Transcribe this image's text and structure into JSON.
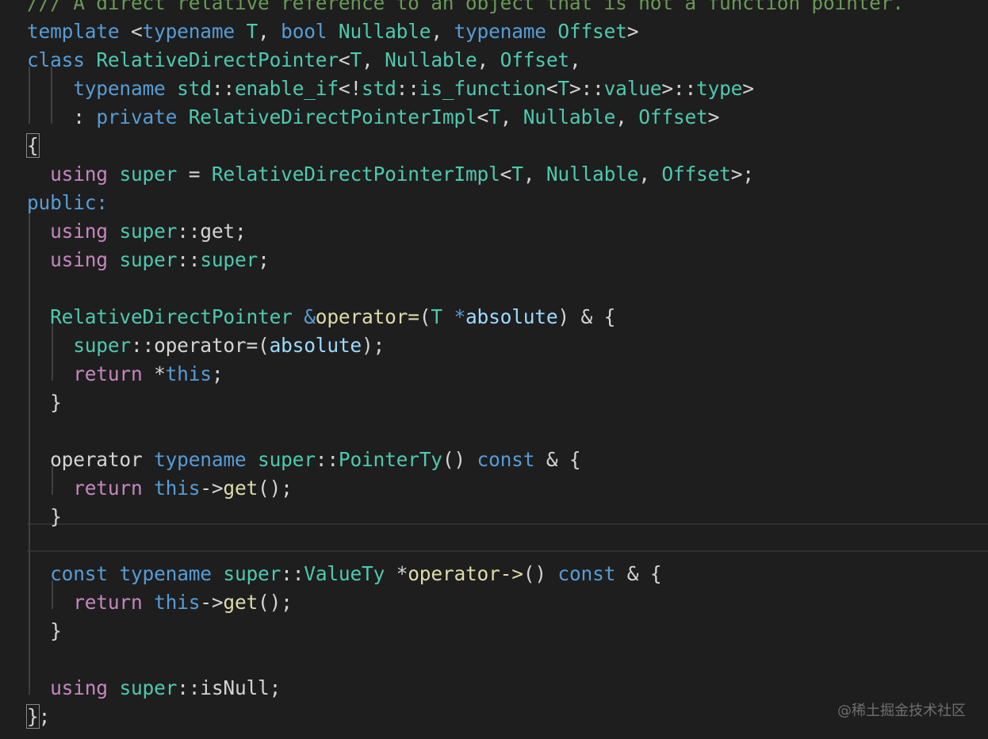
{
  "colors": {
    "background": "#1e1e1e",
    "plain": "#d4d4d4",
    "keyword": "#569cd6",
    "control": "#c586c0",
    "type": "#4ec9b0",
    "function": "#dcdcaa",
    "variable": "#9cdcfe",
    "comment": "#6a9955",
    "watermark": "#6f6f6f"
  },
  "lines": [
    [
      {
        "t": "/// A direct relative reference to an object that is not a function pointer.",
        "c": "comment"
      }
    ],
    [
      {
        "t": "template",
        "c": "keyword"
      },
      {
        "t": " <",
        "c": "plain"
      },
      {
        "t": "typename",
        "c": "keyword"
      },
      {
        "t": " ",
        "c": "plain"
      },
      {
        "t": "T",
        "c": "type"
      },
      {
        "t": ", ",
        "c": "plain"
      },
      {
        "t": "bool",
        "c": "keyword"
      },
      {
        "t": " ",
        "c": "plain"
      },
      {
        "t": "Nullable",
        "c": "type"
      },
      {
        "t": ", ",
        "c": "plain"
      },
      {
        "t": "typename",
        "c": "keyword"
      },
      {
        "t": " ",
        "c": "plain"
      },
      {
        "t": "Offset",
        "c": "type"
      },
      {
        "t": ">",
        "c": "plain"
      }
    ],
    [
      {
        "t": "class",
        "c": "keyword"
      },
      {
        "t": " ",
        "c": "plain"
      },
      {
        "t": "RelativeDirectPointer",
        "c": "type"
      },
      {
        "t": "<",
        "c": "plain"
      },
      {
        "t": "T",
        "c": "type"
      },
      {
        "t": ", ",
        "c": "plain"
      },
      {
        "t": "Nullable",
        "c": "type"
      },
      {
        "t": ", ",
        "c": "plain"
      },
      {
        "t": "Offset",
        "c": "type"
      },
      {
        "t": ",",
        "c": "plain"
      }
    ],
    [
      {
        "t": "    ",
        "c": "plain"
      },
      {
        "t": "typename",
        "c": "keyword"
      },
      {
        "t": " ",
        "c": "plain"
      },
      {
        "t": "std",
        "c": "type"
      },
      {
        "t": "::",
        "c": "plain"
      },
      {
        "t": "enable_if",
        "c": "type"
      },
      {
        "t": "<!",
        "c": "plain"
      },
      {
        "t": "std",
        "c": "type"
      },
      {
        "t": "::",
        "c": "plain"
      },
      {
        "t": "is_function",
        "c": "type"
      },
      {
        "t": "<",
        "c": "plain"
      },
      {
        "t": "T",
        "c": "type"
      },
      {
        "t": ">::",
        "c": "plain"
      },
      {
        "t": "value",
        "c": "type"
      },
      {
        "t": ">::",
        "c": "plain"
      },
      {
        "t": "type",
        "c": "type"
      },
      {
        "t": ">",
        "c": "plain"
      }
    ],
    [
      {
        "t": "    : ",
        "c": "plain"
      },
      {
        "t": "private",
        "c": "keyword"
      },
      {
        "t": " ",
        "c": "plain"
      },
      {
        "t": "RelativeDirectPointerImpl",
        "c": "type"
      },
      {
        "t": "<",
        "c": "plain"
      },
      {
        "t": "T",
        "c": "type"
      },
      {
        "t": ", ",
        "c": "plain"
      },
      {
        "t": "Nullable",
        "c": "type"
      },
      {
        "t": ", ",
        "c": "plain"
      },
      {
        "t": "Offset",
        "c": "type"
      },
      {
        "t": ">",
        "c": "plain"
      }
    ],
    [
      {
        "t": "{",
        "c": "plain",
        "m": 1
      }
    ],
    [
      {
        "t": "  ",
        "c": "plain"
      },
      {
        "t": "using",
        "c": "control"
      },
      {
        "t": " ",
        "c": "plain"
      },
      {
        "t": "super",
        "c": "type"
      },
      {
        "t": " = ",
        "c": "plain"
      },
      {
        "t": "RelativeDirectPointerImpl",
        "c": "type"
      },
      {
        "t": "<",
        "c": "plain"
      },
      {
        "t": "T",
        "c": "type"
      },
      {
        "t": ", ",
        "c": "plain"
      },
      {
        "t": "Nullable",
        "c": "type"
      },
      {
        "t": ", ",
        "c": "plain"
      },
      {
        "t": "Offset",
        "c": "type"
      },
      {
        "t": ">;",
        "c": "plain"
      }
    ],
    [
      {
        "t": "public:",
        "c": "keyword"
      }
    ],
    [
      {
        "t": "  ",
        "c": "plain"
      },
      {
        "t": "using",
        "c": "control"
      },
      {
        "t": " ",
        "c": "plain"
      },
      {
        "t": "super",
        "c": "type"
      },
      {
        "t": "::get;",
        "c": "plain"
      }
    ],
    [
      {
        "t": "  ",
        "c": "plain"
      },
      {
        "t": "using",
        "c": "control"
      },
      {
        "t": " ",
        "c": "plain"
      },
      {
        "t": "super",
        "c": "type"
      },
      {
        "t": "::",
        "c": "plain"
      },
      {
        "t": "super",
        "c": "type"
      },
      {
        "t": ";",
        "c": "plain"
      }
    ],
    [],
    [
      {
        "t": "  ",
        "c": "plain"
      },
      {
        "t": "RelativeDirectPointer",
        "c": "type"
      },
      {
        "t": " ",
        "c": "plain"
      },
      {
        "t": "&",
        "c": "keyword"
      },
      {
        "t": "operator=",
        "c": "function"
      },
      {
        "t": "(",
        "c": "plain"
      },
      {
        "t": "T",
        "c": "type"
      },
      {
        "t": " ",
        "c": "plain"
      },
      {
        "t": "*",
        "c": "keyword"
      },
      {
        "t": "absolute",
        "c": "variable"
      },
      {
        "t": ") & {",
        "c": "plain"
      }
    ],
    [
      {
        "t": "    ",
        "c": "plain"
      },
      {
        "t": "super",
        "c": "type"
      },
      {
        "t": "::operator=(",
        "c": "plain"
      },
      {
        "t": "absolute",
        "c": "variable"
      },
      {
        "t": ");",
        "c": "plain"
      }
    ],
    [
      {
        "t": "    ",
        "c": "plain"
      },
      {
        "t": "return",
        "c": "control"
      },
      {
        "t": " *",
        "c": "plain"
      },
      {
        "t": "this",
        "c": "keyword"
      },
      {
        "t": ";",
        "c": "plain"
      }
    ],
    [
      {
        "t": "  }",
        "c": "plain"
      }
    ],
    [],
    [
      {
        "t": "  operator ",
        "c": "plain"
      },
      {
        "t": "typename",
        "c": "keyword"
      },
      {
        "t": " ",
        "c": "plain"
      },
      {
        "t": "super",
        "c": "type"
      },
      {
        "t": "::",
        "c": "plain"
      },
      {
        "t": "PointerTy",
        "c": "type"
      },
      {
        "t": "() ",
        "c": "plain"
      },
      {
        "t": "const",
        "c": "keyword"
      },
      {
        "t": " & {",
        "c": "plain"
      }
    ],
    [
      {
        "t": "    ",
        "c": "plain"
      },
      {
        "t": "return",
        "c": "control"
      },
      {
        "t": " ",
        "c": "plain"
      },
      {
        "t": "this",
        "c": "keyword"
      },
      {
        "t": "->",
        "c": "plain"
      },
      {
        "t": "get",
        "c": "function"
      },
      {
        "t": "();",
        "c": "plain"
      }
    ],
    [
      {
        "t": "  }",
        "c": "plain"
      }
    ],
    [],
    [
      {
        "t": "  ",
        "c": "plain"
      },
      {
        "t": "const",
        "c": "keyword"
      },
      {
        "t": " ",
        "c": "plain"
      },
      {
        "t": "typename",
        "c": "keyword"
      },
      {
        "t": " ",
        "c": "plain"
      },
      {
        "t": "super",
        "c": "type"
      },
      {
        "t": "::",
        "c": "plain"
      },
      {
        "t": "ValueTy",
        "c": "type"
      },
      {
        "t": " *",
        "c": "plain"
      },
      {
        "t": "operator->",
        "c": "function"
      },
      {
        "t": "() ",
        "c": "plain"
      },
      {
        "t": "const",
        "c": "keyword"
      },
      {
        "t": " & {",
        "c": "plain"
      }
    ],
    [
      {
        "t": "    ",
        "c": "plain"
      },
      {
        "t": "return",
        "c": "control"
      },
      {
        "t": " ",
        "c": "plain"
      },
      {
        "t": "this",
        "c": "keyword"
      },
      {
        "t": "->",
        "c": "plain"
      },
      {
        "t": "get",
        "c": "function"
      },
      {
        "t": "();",
        "c": "plain"
      }
    ],
    [
      {
        "t": "  }",
        "c": "plain"
      }
    ],
    [],
    [
      {
        "t": "  ",
        "c": "plain"
      },
      {
        "t": "using",
        "c": "control"
      },
      {
        "t": " ",
        "c": "plain"
      },
      {
        "t": "super",
        "c": "type"
      },
      {
        "t": "::isNull;",
        "c": "plain"
      }
    ],
    [
      {
        "t": "}",
        "c": "plain",
        "m": 1
      },
      {
        "t": ";",
        "c": "plain"
      }
    ]
  ],
  "watermark": "@稀土掘金技术社区"
}
